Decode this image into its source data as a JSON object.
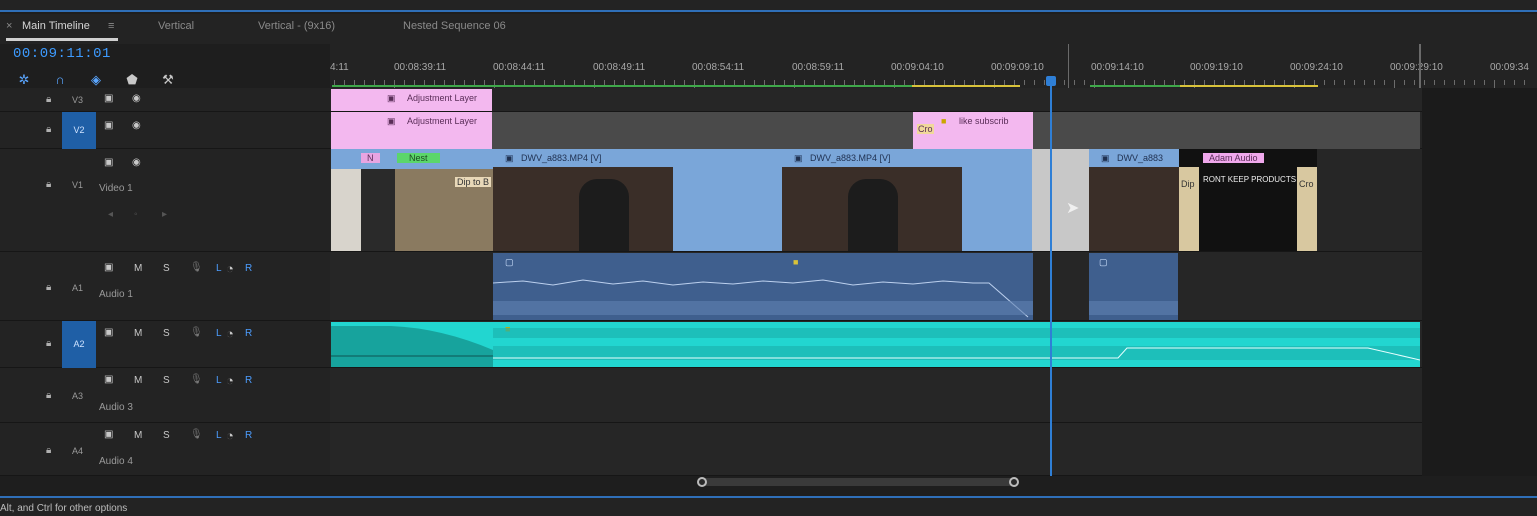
{
  "tabs": [
    {
      "close": "×",
      "label": "Main Timeline",
      "menu": "≡"
    },
    {
      "label": "Vertical"
    },
    {
      "label": "Vertical - (9x16)"
    },
    {
      "label": "Nested Sequence 06"
    }
  ],
  "timecode": "00:09:11:01",
  "ruler_labels": [
    "4:11",
    "00:08:39:11",
    "00:08:44:11",
    "00:08:49:11",
    "00:08:54:11",
    "00:08:59:11",
    "00:09:04:10",
    "00:09:09:10",
    "00:09:14:10",
    "00:09:19:10",
    "00:09:24:10",
    "00:09:29:10",
    "00:09:34"
  ],
  "video_tracks": [
    {
      "id": "V3",
      "name": ""
    },
    {
      "id": "V2",
      "name": ""
    },
    {
      "id": "V1",
      "name": "Video 1"
    }
  ],
  "audio_tracks": [
    {
      "id": "A1",
      "name": "Audio 1"
    },
    {
      "id": "A2",
      "name": ""
    },
    {
      "id": "A3",
      "name": "Audio 3"
    },
    {
      "id": "A4",
      "name": "Audio 4"
    }
  ],
  "audio_controls": {
    "m": "M",
    "s": "S",
    "l": "L",
    "r": "R"
  },
  "clips": {
    "adj1": "Adjustment Layer",
    "adj2": "Adjustment Layer",
    "like": "like subscrib",
    "n": "N",
    "nest": "Nest",
    "dip1": "Dip to B",
    "dwv1": "DWV_a883.MP4 [V]",
    "dwv2": "DWV_a883.MP4 [V]",
    "dwv3": "DWV_a883",
    "adam": "Adam Audio",
    "cro1": "Cro",
    "cro2": "Cro",
    "dip2": "Dip",
    "text1": "RONT KEEP PRODUCTS"
  },
  "status_text": "Alt, and Ctrl for other options",
  "colors": {
    "accent": "#2f7fd6",
    "timecode": "#3d9bff",
    "audio_clip": "#22d6d0",
    "adjustment": "#f3b8ef"
  }
}
